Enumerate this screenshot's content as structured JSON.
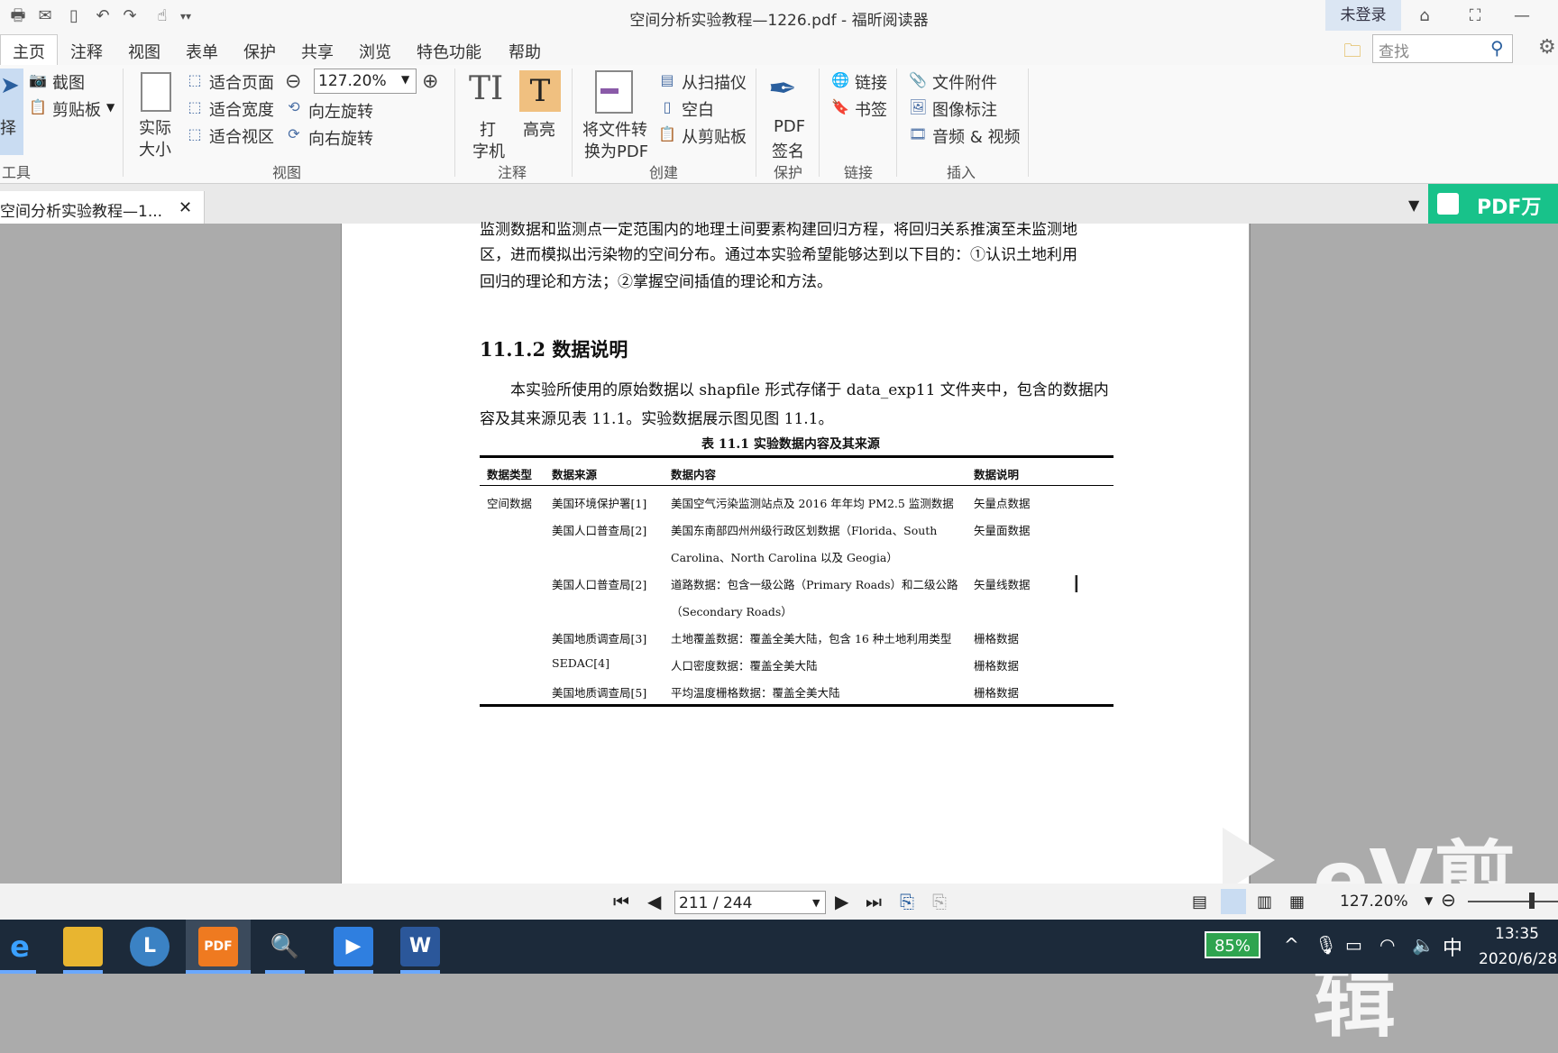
{
  "window": {
    "title": "空间分析实验教程—1226.pdf - 福昕阅读器",
    "login": "未登录"
  },
  "menu": [
    "主页",
    "注释",
    "视图",
    "表单",
    "保护",
    "共享",
    "浏览",
    "特色功能",
    "帮助"
  ],
  "search": {
    "placeholder": "查找"
  },
  "ribbon": {
    "tools": {
      "select_label": "择",
      "screenshot": "截图",
      "clipboard": "剪贴板",
      "group": "工具"
    },
    "view": {
      "actual_size_1": "实际",
      "actual_size_2": "大小",
      "fit_page": "适合页面",
      "fit_width": "适合宽度",
      "fit_visible": "适合视区",
      "zoom": "127.20%",
      "rotate_left": "向左旋转",
      "rotate_right": "向右旋转",
      "group": "视图"
    },
    "comment": {
      "typewriter_1": "打",
      "typewriter_2": "字机",
      "highlight": "高亮",
      "group": "注释"
    },
    "create": {
      "convert_1": "将文件转",
      "convert_2": "换为PDF",
      "from_scanner": "从扫描仪",
      "blank": "空白",
      "from_clipboard": "从剪贴板",
      "group": "创建"
    },
    "protect": {
      "sign_1": "PDF",
      "sign_2": "签名",
      "group": "保护"
    },
    "links": {
      "link": "链接",
      "bookmark": "书签",
      "group": "链接"
    },
    "insert": {
      "attachment": "文件附件",
      "image_annot": "图像标注",
      "audio_video": "音频 & 视频",
      "group": "插入"
    }
  },
  "doc_tab": {
    "label": "空间分析实验教程—1...",
    "close": "✕"
  },
  "promo": "PDF万",
  "page": {
    "line0": "监测数据和监测点一定范围内的地理土间要素构建回归方程，将回归关系推演至未监测地",
    "line1": "区，进而模拟出污染物的空间分布。通过本实验希望能够达到以下目的：①认识土地利用",
    "line2": "回归的理论和方法；②掌握空间插值的理论和方法。",
    "heading": "11.1.2 数据说明",
    "para1": "本实验所使用的原始数据以 shapfile 形式存储于 data_exp11 文件夹中，包含的数据内",
    "para2": "容及其来源见表 11.1。实验数据展示图见图 11.1。",
    "table_caption": "表 11.1  实验数据内容及其来源",
    "headers": [
      "数据类型",
      "数据来源",
      "数据内容",
      "数据说明"
    ],
    "rows": [
      {
        "type": "空间数据",
        "source": "美国环境保护署[1]",
        "content": "美国空气污染监测站点及 2016 年年均 PM2.5 监测数据",
        "content2": "",
        "desc": "矢量点数据"
      },
      {
        "type": "",
        "source": "美国人口普查局[2]",
        "content": "美国东南部四州州级行政区划数据（Florida、South",
        "content2": "Carolina、North Carolina 以及 Geogia）",
        "desc": "矢量面数据"
      },
      {
        "type": "",
        "source": "美国人口普查局[2]",
        "content": "道路数据：包含一级公路（Primary Roads）和二级公路",
        "content2": "（Secondary Roads）",
        "desc": "矢量线数据"
      },
      {
        "type": "",
        "source": "美国地质调查局[3]",
        "content": "土地覆盖数据：覆盖全美大陆，包含 16 种土地利用类型",
        "content2": "",
        "desc": "栅格数据"
      },
      {
        "type": "",
        "source": "SEDAC[4]",
        "content": "人口密度数据：覆盖全美大陆",
        "content2": "",
        "desc": "栅格数据"
      },
      {
        "type": "",
        "source": "美国地质调查局[5]",
        "content": "平均温度栅格数据：覆盖全美大陆",
        "content2": "",
        "desc": "栅格数据"
      }
    ]
  },
  "nav": {
    "page": "211 / 244",
    "zoom": "127.20%"
  },
  "watermark": {
    "text": "eV剪辑"
  },
  "taskbar": {
    "battery": "85%",
    "ime": "中",
    "time": "13:35",
    "date": "2020/6/28"
  }
}
